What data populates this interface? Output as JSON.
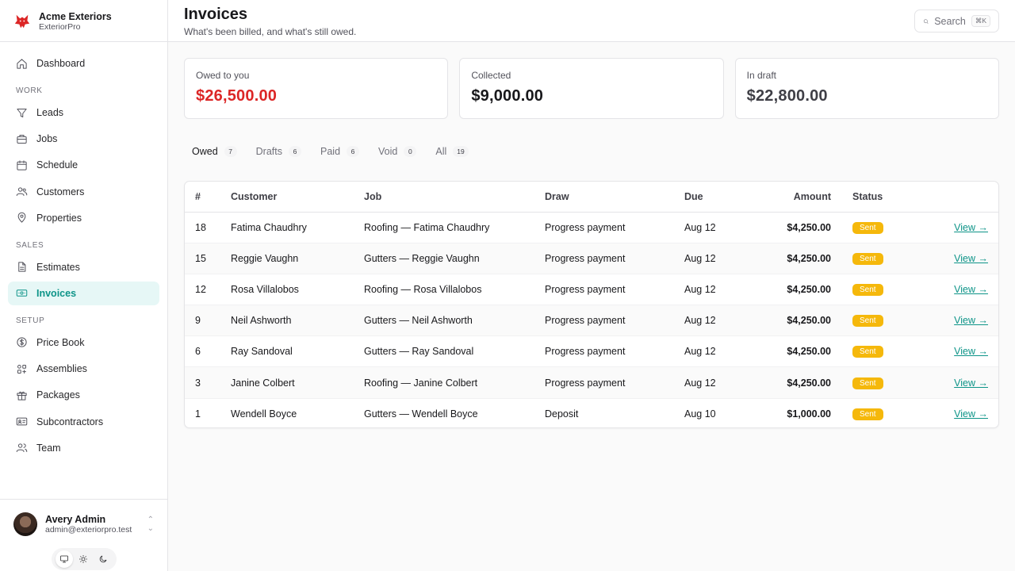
{
  "brand": {
    "name": "Acme Exteriors",
    "sub": "ExteriorPro"
  },
  "nav": {
    "dashboard": "Dashboard",
    "work_label": "WORK",
    "work": [
      "Leads",
      "Jobs",
      "Schedule",
      "Customers",
      "Properties"
    ],
    "sales_label": "SALES",
    "sales": [
      "Estimates",
      "Invoices"
    ],
    "setup_label": "SETUP",
    "setup": [
      "Price Book",
      "Assemblies",
      "Packages",
      "Subcontractors",
      "Team"
    ],
    "active": "Invoices"
  },
  "user": {
    "name": "Avery Admin",
    "email": "admin@exteriorpro.test"
  },
  "header": {
    "title": "Invoices",
    "subtitle": "What's been billed, and what's still owed."
  },
  "search": {
    "label": "Search",
    "shortcut": "⌘K"
  },
  "cards": [
    {
      "label": "Owed to you",
      "value": "$26,500.00"
    },
    {
      "label": "Collected",
      "value": "$9,000.00"
    },
    {
      "label": "In draft",
      "value": "$22,800.00"
    }
  ],
  "tabs": [
    {
      "label": "Owed",
      "count": "7"
    },
    {
      "label": "Drafts",
      "count": "6"
    },
    {
      "label": "Paid",
      "count": "6"
    },
    {
      "label": "Void",
      "count": "0"
    },
    {
      "label": "All",
      "count": "19"
    }
  ],
  "table": {
    "headers": {
      "num": "#",
      "customer": "Customer",
      "job": "Job",
      "draw": "Draw",
      "due": "Due",
      "amount": "Amount",
      "status": "Status"
    },
    "rows": [
      {
        "num": "18",
        "customer": "Fatima Chaudhry",
        "job": "Roofing — Fatima Chaudhry",
        "draw": "Progress payment",
        "due": "Aug 12",
        "amount": "$4,250.00",
        "status": "Sent",
        "action": "View →"
      },
      {
        "num": "15",
        "customer": "Reggie Vaughn",
        "job": "Gutters — Reggie Vaughn",
        "draw": "Progress payment",
        "due": "Aug 12",
        "amount": "$4,250.00",
        "status": "Sent",
        "action": "View →"
      },
      {
        "num": "12",
        "customer": "Rosa Villalobos",
        "job": "Roofing — Rosa Villalobos",
        "draw": "Progress payment",
        "due": "Aug 12",
        "amount": "$4,250.00",
        "status": "Sent",
        "action": "View →"
      },
      {
        "num": "9",
        "customer": "Neil Ashworth",
        "job": "Gutters — Neil Ashworth",
        "draw": "Progress payment",
        "due": "Aug 12",
        "amount": "$4,250.00",
        "status": "Sent",
        "action": "View →"
      },
      {
        "num": "6",
        "customer": "Ray Sandoval",
        "job": "Gutters — Ray Sandoval",
        "draw": "Progress payment",
        "due": "Aug 12",
        "amount": "$4,250.00",
        "status": "Sent",
        "action": "View →"
      },
      {
        "num": "3",
        "customer": "Janine Colbert",
        "job": "Roofing — Janine Colbert",
        "draw": "Progress payment",
        "due": "Aug 12",
        "amount": "$4,250.00",
        "status": "Sent",
        "action": "View →"
      },
      {
        "num": "1",
        "customer": "Wendell Boyce",
        "job": "Gutters — Wendell Boyce",
        "draw": "Deposit",
        "due": "Aug 10",
        "amount": "$1,000.00",
        "status": "Sent",
        "action": "View →"
      }
    ]
  },
  "colors": {
    "accent": "#0d9488",
    "owed": "#dc2626",
    "badge": "#f5b80b",
    "logo": "#dc2626"
  },
  "icons": {
    "brand": "wolf-logo-icon",
    "dashboard": "home-icon",
    "leads": "funnel-icon",
    "jobs": "briefcase-icon",
    "schedule": "calendar-icon",
    "customers": "users-icon",
    "properties": "map-pin-icon",
    "estimates": "file-text-icon",
    "invoices": "banknote-icon",
    "price_book": "dollar-circle-icon",
    "assemblies": "grid-icon",
    "packages": "gift-icon",
    "subcontractors": "id-card-icon",
    "team": "team-icon"
  }
}
